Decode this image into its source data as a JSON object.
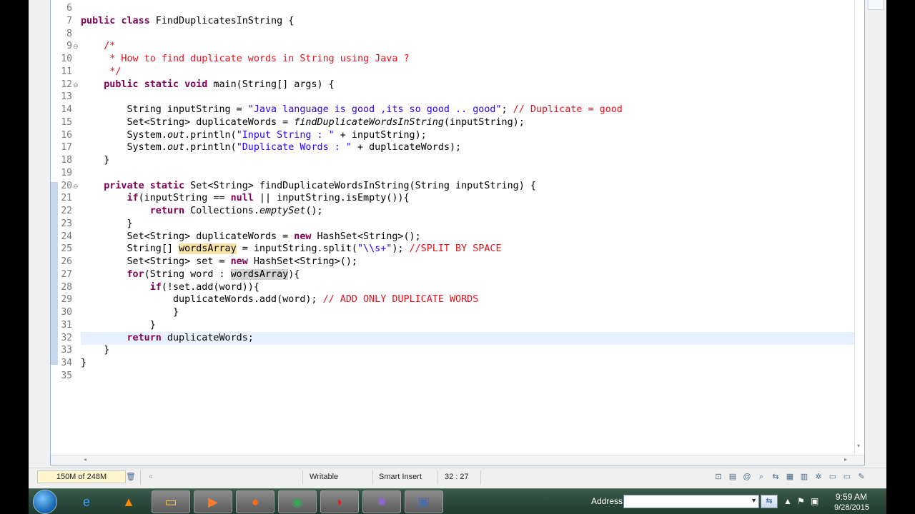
{
  "editor": {
    "lines": [
      {
        "n": "6",
        "tokens": []
      },
      {
        "n": "7",
        "tokens": [
          {
            "t": "kw",
            "v": "public"
          },
          {
            "t": "",
            "v": " "
          },
          {
            "t": "kw",
            "v": "class"
          },
          {
            "t": "",
            "v": " FindDuplicatesInString {"
          }
        ]
      },
      {
        "n": "8",
        "tokens": []
      },
      {
        "n": "9",
        "fold": "⊖",
        "tokens": [
          {
            "t": "cm",
            "v": "    /*"
          }
        ]
      },
      {
        "n": "10",
        "tokens": [
          {
            "t": "cm",
            "v": "     * How to find duplicate words in String using Java ?"
          }
        ]
      },
      {
        "n": "11",
        "tokens": [
          {
            "t": "cm",
            "v": "     */"
          }
        ]
      },
      {
        "n": "12",
        "fold": "⊖",
        "tokens": [
          {
            "t": "",
            "v": "    "
          },
          {
            "t": "kw",
            "v": "public"
          },
          {
            "t": "",
            "v": " "
          },
          {
            "t": "kw",
            "v": "static"
          },
          {
            "t": "",
            "v": " "
          },
          {
            "t": "kw",
            "v": "void"
          },
          {
            "t": "",
            "v": " main(String[] args) {"
          }
        ]
      },
      {
        "n": "13",
        "tokens": []
      },
      {
        "n": "14",
        "tokens": [
          {
            "t": "",
            "v": "        String inputString = "
          },
          {
            "t": "str",
            "v": "\"Java language is good ,its so good .. good\""
          },
          {
            "t": "",
            "v": "; "
          },
          {
            "t": "cm",
            "v": "// Duplicate = good"
          }
        ]
      },
      {
        "n": "15",
        "tokens": [
          {
            "t": "",
            "v": "        Set<String> duplicateWords = "
          },
          {
            "t": "it",
            "v": "findDuplicateWordsInString"
          },
          {
            "t": "",
            "v": "(inputString);"
          }
        ]
      },
      {
        "n": "16",
        "tokens": [
          {
            "t": "",
            "v": "        System."
          },
          {
            "t": "it",
            "v": "out"
          },
          {
            "t": "",
            "v": ".println("
          },
          {
            "t": "str",
            "v": "\"Input String : \""
          },
          {
            "t": "",
            "v": " + inputString);"
          }
        ]
      },
      {
        "n": "17",
        "tokens": [
          {
            "t": "",
            "v": "        System."
          },
          {
            "t": "it",
            "v": "out"
          },
          {
            "t": "",
            "v": ".println("
          },
          {
            "t": "str",
            "v": "\"Duplicate Words : \""
          },
          {
            "t": "",
            "v": " + duplicateWords);"
          }
        ]
      },
      {
        "n": "18",
        "tokens": [
          {
            "t": "",
            "v": "    }"
          }
        ]
      },
      {
        "n": "19",
        "tokens": []
      },
      {
        "n": "20",
        "fold": "⊖",
        "tokens": [
          {
            "t": "",
            "v": "    "
          },
          {
            "t": "kw",
            "v": "private"
          },
          {
            "t": "",
            "v": " "
          },
          {
            "t": "kw",
            "v": "static"
          },
          {
            "t": "",
            "v": " Set<String> findDuplicateWordsInString(String inputString) {"
          }
        ]
      },
      {
        "n": "21",
        "tokens": [
          {
            "t": "",
            "v": "        "
          },
          {
            "t": "kw",
            "v": "if"
          },
          {
            "t": "",
            "v": "(inputString == "
          },
          {
            "t": "kw",
            "v": "null"
          },
          {
            "t": "",
            "v": " || inputString.isEmpty()){"
          }
        ]
      },
      {
        "n": "22",
        "tokens": [
          {
            "t": "",
            "v": "            "
          },
          {
            "t": "kw",
            "v": "return"
          },
          {
            "t": "",
            "v": " Collections."
          },
          {
            "t": "it",
            "v": "emptySet"
          },
          {
            "t": "",
            "v": "();"
          }
        ]
      },
      {
        "n": "23",
        "tokens": [
          {
            "t": "",
            "v": "        }"
          }
        ]
      },
      {
        "n": "24",
        "tokens": [
          {
            "t": "",
            "v": "        Set<String> duplicateWords = "
          },
          {
            "t": "kw",
            "v": "new"
          },
          {
            "t": "",
            "v": " HashSet<String>();"
          }
        ]
      },
      {
        "n": "25",
        "tokens": [
          {
            "t": "",
            "v": "        String[] "
          },
          {
            "t": "hl-yellow",
            "v": "wordsArray"
          },
          {
            "t": "",
            "v": " = inputString.split("
          },
          {
            "t": "str",
            "v": "\"\\\\s+\""
          },
          {
            "t": "",
            "v": "); "
          },
          {
            "t": "cm",
            "v": "//SPLIT BY SPACE"
          }
        ]
      },
      {
        "n": "26",
        "tokens": [
          {
            "t": "",
            "v": "        Set<String> set = "
          },
          {
            "t": "kw",
            "v": "new"
          },
          {
            "t": "",
            "v": " HashSet<String>();"
          }
        ]
      },
      {
        "n": "27",
        "tokens": [
          {
            "t": "",
            "v": "        "
          },
          {
            "t": "kw",
            "v": "for"
          },
          {
            "t": "",
            "v": "(String word : "
          },
          {
            "t": "hl-gray",
            "v": "wordsArray"
          },
          {
            "t": "",
            "v": "){"
          }
        ]
      },
      {
        "n": "28",
        "tokens": [
          {
            "t": "",
            "v": "            "
          },
          {
            "t": "kw",
            "v": "if"
          },
          {
            "t": "",
            "v": "(!set.add(word)){"
          }
        ]
      },
      {
        "n": "29",
        "tokens": [
          {
            "t": "",
            "v": "                duplicateWords.add(word); "
          },
          {
            "t": "cm",
            "v": "// ADD ONLY DUPLICATE WORDS"
          }
        ]
      },
      {
        "n": "30",
        "tokens": [
          {
            "t": "",
            "v": "                }"
          }
        ]
      },
      {
        "n": "31",
        "tokens": [
          {
            "t": "",
            "v": "            }"
          }
        ]
      },
      {
        "n": "32",
        "current": true,
        "tokens": [
          {
            "t": "",
            "v": "        "
          },
          {
            "t": "kw",
            "v": "return"
          },
          {
            "t": "",
            "v": " duplicateWords;"
          }
        ]
      },
      {
        "n": "33",
        "tokens": [
          {
            "t": "",
            "v": "    }"
          }
        ]
      },
      {
        "n": "34",
        "tokens": [
          {
            "t": "",
            "v": "}"
          }
        ]
      },
      {
        "n": "35",
        "tokens": []
      }
    ]
  },
  "status_bar": {
    "memory": "150M of 248M",
    "writable": "Writable",
    "insert_mode": "Smart Insert",
    "position": "32 : 27"
  },
  "taskbar": {
    "apps": [
      {
        "icon": "internet-explorer-icon",
        "glyph": "e",
        "color": "#3aa0ff"
      },
      {
        "icon": "vlc-icon",
        "glyph": "▲",
        "color": "#ff8a00"
      },
      {
        "icon": "file-explorer-icon",
        "glyph": "▭",
        "color": "#f2c94c"
      },
      {
        "icon": "media-player-icon",
        "glyph": "▶",
        "color": "#ff7a2a"
      },
      {
        "icon": "firefox-icon",
        "glyph": "●",
        "color": "#ff6a1a"
      },
      {
        "icon": "chrome-icon",
        "glyph": "◉",
        "color": "#34a853"
      },
      {
        "icon": "red-app-icon",
        "glyph": "◗",
        "color": "#e02020"
      },
      {
        "icon": "java-ee-ide-icon",
        "glyph": "✹",
        "color": "#8a6ac8"
      },
      {
        "icon": "save-disk-icon",
        "glyph": "▣",
        "color": "#4a6aa8"
      }
    ],
    "address_label": "Address",
    "clock_time": "9:59 AM",
    "clock_date": "9/28/2015"
  }
}
